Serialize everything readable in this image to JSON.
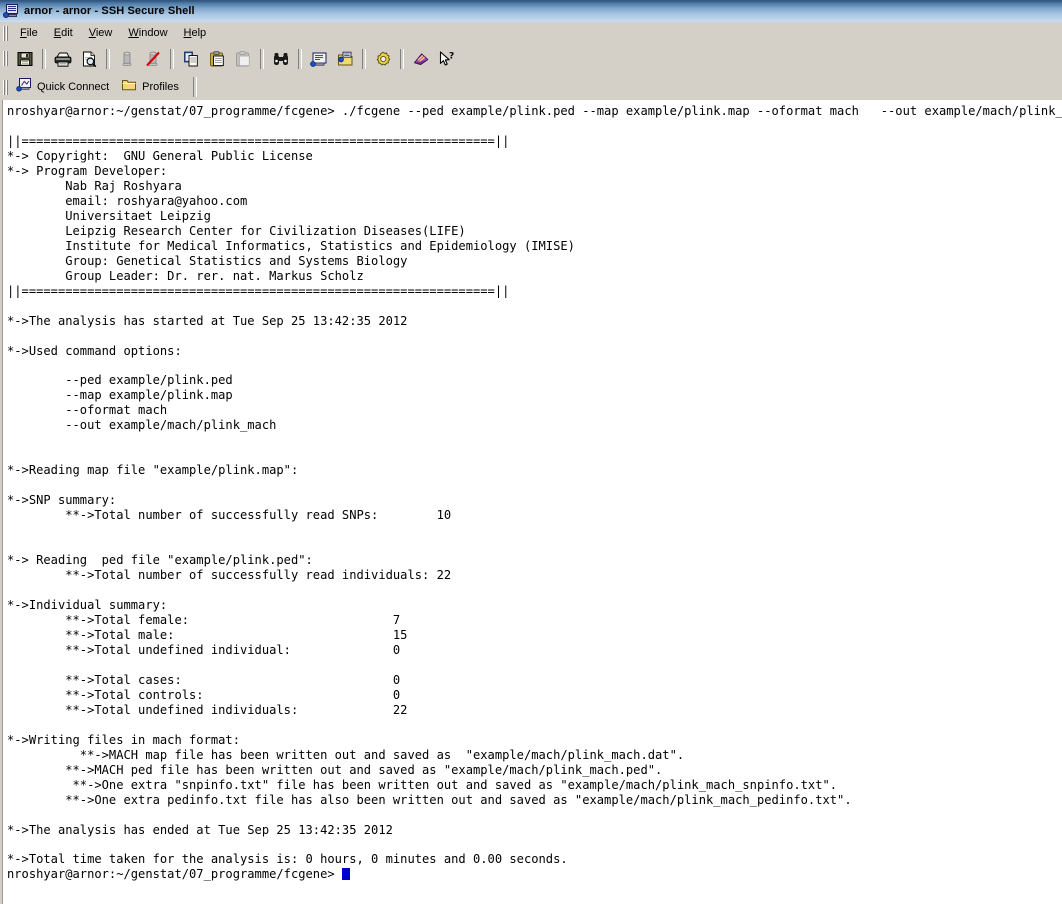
{
  "window": {
    "title": "arnor - arnor - SSH Secure Shell",
    "title_icon": "ssh-terminal-icon"
  },
  "menu": {
    "items": [
      {
        "label": "File",
        "accel": "F"
      },
      {
        "label": "Edit",
        "accel": "E"
      },
      {
        "label": "View",
        "accel": "V"
      },
      {
        "label": "Window",
        "accel": "W"
      },
      {
        "label": "Help",
        "accel": "H"
      }
    ]
  },
  "toolbar": {
    "groups": [
      {
        "buttons": [
          {
            "icon": "save-floppy-icon",
            "name": "save-button"
          }
        ]
      },
      {
        "buttons": [
          {
            "icon": "printer-icon",
            "name": "print-button"
          },
          {
            "icon": "print-preview-icon",
            "name": "print-preview-button"
          }
        ]
      },
      {
        "buttons": [
          {
            "icon": "connect-icon",
            "name": "connect-button"
          },
          {
            "icon": "disconnect-icon",
            "name": "disconnect-button"
          }
        ]
      },
      {
        "buttons": [
          {
            "icon": "copy-icon",
            "name": "copy-button"
          },
          {
            "icon": "paste-icon",
            "name": "paste-button"
          },
          {
            "icon": "paste-disabled-icon",
            "name": "paste-special-button"
          }
        ]
      },
      {
        "buttons": [
          {
            "icon": "find-binoculars-icon",
            "name": "find-button"
          }
        ]
      },
      {
        "buttons": [
          {
            "icon": "new-terminal-icon",
            "name": "new-terminal-button"
          },
          {
            "icon": "file-transfer-icon",
            "name": "file-transfer-button"
          }
        ]
      },
      {
        "buttons": [
          {
            "icon": "settings-gear-icon",
            "name": "settings-button"
          }
        ]
      },
      {
        "buttons": [
          {
            "icon": "help-book-icon",
            "name": "help-book-button"
          },
          {
            "icon": "context-help-arrow-icon",
            "name": "context-help-button"
          }
        ]
      }
    ]
  },
  "connect_bar": {
    "quick_connect": {
      "label": "Quick Connect",
      "icon": "quick-connect-icon"
    },
    "profiles": {
      "label": "Profiles",
      "icon": "folder-icon"
    }
  },
  "terminal": {
    "prompt": "nroshyar@arnor:~/genstat/07_programme/fcgene>",
    "cursor": "block-cursor",
    "lines": [
      "nroshyar@arnor:~/genstat/07_programme/fcgene> ./fcgene --ped example/plink.ped --map example/plink.map --oformat mach   --out example/mach/plink_mach",
      "",
      "||=================================================================||",
      "*-> Copyright:  GNU General Public License",
      "*-> Program Developer:",
      "        Nab Raj Roshyara",
      "        email: roshyara@yahoo.com",
      "        Universitaet Leipzig",
      "        Leipzig Research Center for Civilization Diseases(LIFE)",
      "        Institute for Medical Informatics, Statistics and Epidemiology (IMISE)",
      "        Group: Genetical Statistics and Systems Biology",
      "        Group Leader: Dr. rer. nat. Markus Scholz",
      "||=================================================================||",
      "",
      "*->The analysis has started at Tue Sep 25 13:42:35 2012",
      "",
      "*->Used command options:",
      "",
      "        --ped example/plink.ped",
      "        --map example/plink.map",
      "        --oformat mach",
      "        --out example/mach/plink_mach",
      "",
      "",
      "*->Reading map file \"example/plink.map\":",
      "",
      "*->SNP summary:",
      "        **->Total number of successfully read SNPs:        10",
      "",
      "",
      "*-> Reading  ped file \"example/plink.ped\":",
      "        **->Total number of successfully read individuals: 22",
      "",
      "*->Individual summary:",
      "        **->Total female:                            7",
      "        **->Total male:                              15",
      "        **->Total undefined individual:              0",
      "",
      "        **->Total cases:                             0",
      "        **->Total controls:                          0",
      "        **->Total undefined individuals:             22",
      "",
      "*->Writing files in mach format:",
      "          **->MACH map file has been written out and saved as  \"example/mach/plink_mach.dat\".",
      "        **->MACH ped file has been written out and saved as \"example/mach/plink_mach.ped\".",
      "         **->One extra \"snpinfo.txt\" file has been written out and saved as \"example/mach/plink_mach_snpinfo.txt\".",
      "        **->One extra pedinfo.txt file has also been written out and saved as \"example/mach/plink_mach_pedinfo.txt\".",
      "",
      "*->The analysis has ended at Tue Sep 25 13:42:35 2012",
      "",
      "*->Total time taken for the analysis is: 0 hours, 0 minutes and 0.00 seconds."
    ],
    "last_line_prompt": "nroshyar@arnor:~/genstat/07_programme/fcgene> "
  },
  "colors": {
    "title_gradient_start": "#2f5484",
    "title_gradient_end": "#c9dcef",
    "chrome": "#d4d0c8",
    "terminal_bg": "#ffffff",
    "terminal_fg": "#000000",
    "cursor": "#0000cc"
  }
}
